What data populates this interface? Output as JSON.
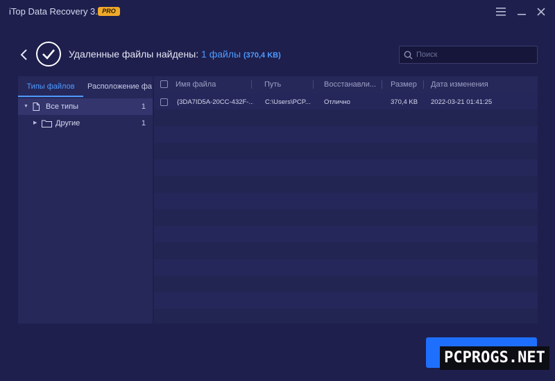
{
  "window": {
    "title": "iTop Data Recovery 3.0",
    "badge": "PRO",
    "menu_icon": "hamburger-icon",
    "minimize_icon": "minimize-icon",
    "close_icon": "close-icon"
  },
  "header": {
    "headline_prefix": "Удаленные файлы найдены:",
    "file_count": "1 файлы",
    "total_size": "(370,4 KB)",
    "search_placeholder": "Поиск"
  },
  "left_panel": {
    "tabs": [
      {
        "label": "Типы файлов",
        "active": true
      },
      {
        "label": "Расположение фа",
        "active": false
      }
    ],
    "tree": [
      {
        "label": "Все типы",
        "count": "1",
        "selected": true
      },
      {
        "label": "Другие",
        "count": "1",
        "selected": false
      }
    ]
  },
  "table": {
    "columns": [
      "Имя файла",
      "Путь",
      "Восстанавли...",
      "Размер",
      "Дата изменения"
    ],
    "rows": [
      {
        "name": "{3DA7ID5A-20CC-432F-...",
        "path": "C:\\Users\\PCP...",
        "recoverability": "Отлично",
        "size": "370,4 KB",
        "modified": "2022-03-21 01:41:25"
      }
    ]
  },
  "watermark": "PCPROGS.NET",
  "colors": {
    "accent": "#4e9bff",
    "button": "#1f6fff",
    "background": "#1e1f4d",
    "badge": "#f0a92a"
  }
}
